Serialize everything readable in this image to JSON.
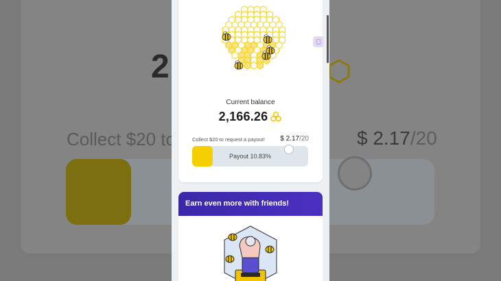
{
  "background": {
    "balance_partial": "2",
    "collect_text": "Collect $20 to",
    "amount_current": "$ 2.17",
    "amount_target": "/20"
  },
  "balance": {
    "label": "Current balance",
    "value": "2,166.26",
    "coin_icon": "honeycomb-coin-icon"
  },
  "payout": {
    "collect_text": "Collect $20 to request a payout!",
    "amount_current": "$ 2.17",
    "amount_target": "/20",
    "progress_label": "Payout 10.83%",
    "progress_fraction": 0.1083
  },
  "friends": {
    "title": "Earn even more with friends!"
  },
  "colors": {
    "accent_yellow": "#f5d000",
    "banner_purple": "#3a28a8",
    "track": "#dfe6ec"
  }
}
